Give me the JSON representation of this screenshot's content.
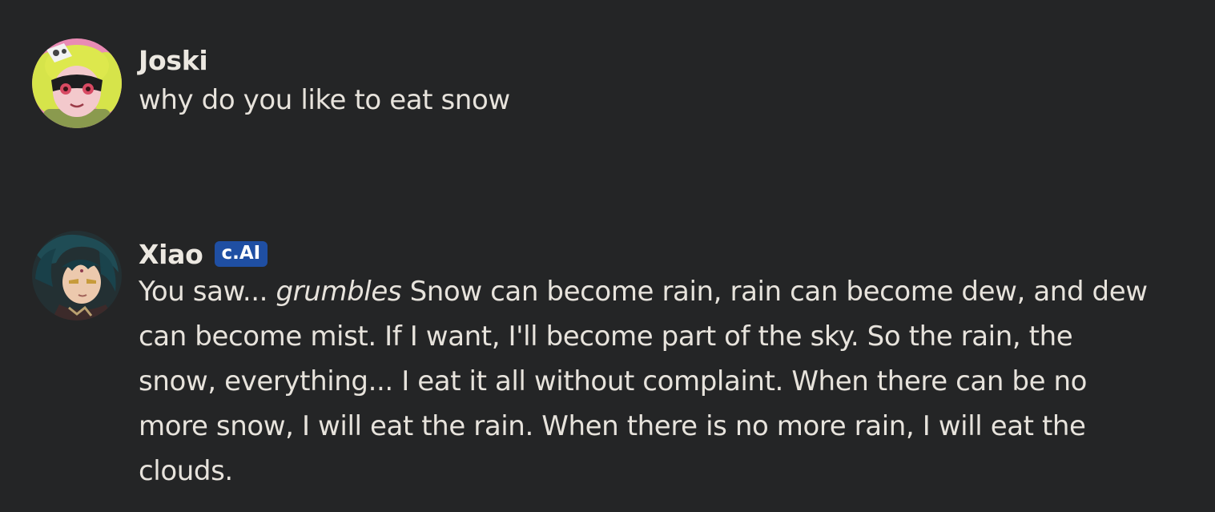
{
  "messages": [
    {
      "author": "Joski",
      "avatar_icon": "joski-avatar",
      "text": "why do you like to eat snow"
    },
    {
      "author": "Xiao",
      "badge": "c.AI",
      "avatar_icon": "xiao-avatar",
      "text_parts": {
        "lead": "You saw... ",
        "emphasis": "grumbles",
        "rest": " Snow can become rain, rain can become dew, and dew can become mist. If I want, I'll become part of the sky. So the rain, the snow, everything... I eat it all without complaint. When there can be no more snow, I will eat the rain. When there is no more rain, I will eat the clouds."
      }
    }
  ],
  "colors": {
    "background": "#242526",
    "text": "#e7e3dc",
    "badge": "#1f4fa3"
  }
}
